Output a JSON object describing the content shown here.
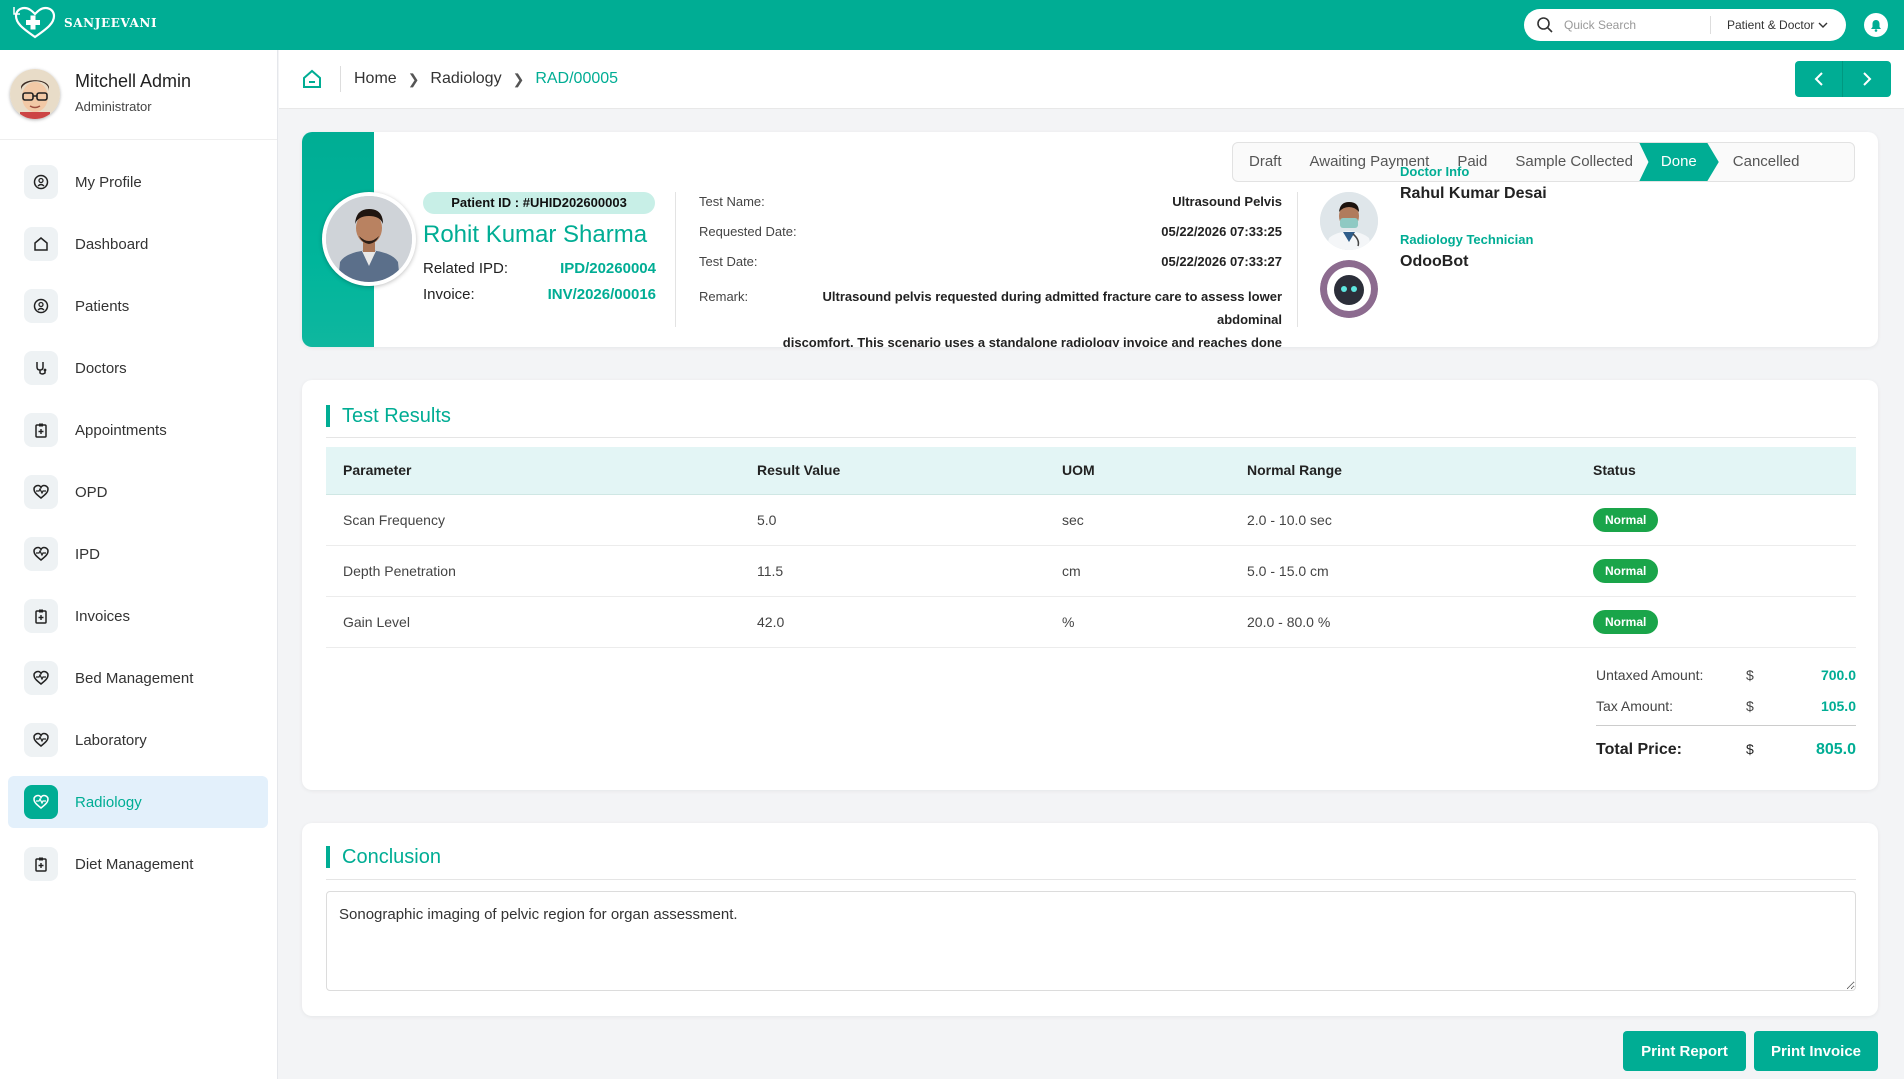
{
  "app": {
    "brand": "Sanjeevani"
  },
  "search": {
    "placeholder": "Quick Search",
    "filter_label": "Patient & Doctor"
  },
  "user": {
    "name": "Mitchell Admin",
    "role": "Administrator"
  },
  "sidebar": {
    "items": [
      {
        "label": "My Profile",
        "icon": "user-circle-icon"
      },
      {
        "label": "Dashboard",
        "icon": "home-icon"
      },
      {
        "label": "Patients",
        "icon": "user-circle-icon"
      },
      {
        "label": "Doctors",
        "icon": "stethoscope-icon"
      },
      {
        "label": "Appointments",
        "icon": "clipboard-icon"
      },
      {
        "label": "OPD",
        "icon": "heart-pulse-icon"
      },
      {
        "label": "IPD",
        "icon": "heart-pulse-icon"
      },
      {
        "label": "Invoices",
        "icon": "clipboard-icon"
      },
      {
        "label": "Bed Management",
        "icon": "heart-pulse-icon"
      },
      {
        "label": "Laboratory",
        "icon": "heart-pulse-icon"
      },
      {
        "label": "Radiology",
        "icon": "heart-pulse-icon",
        "active": true
      },
      {
        "label": "Diet Management",
        "icon": "clipboard-icon"
      }
    ]
  },
  "breadcrumb": {
    "home": "Home",
    "section": "Radiology",
    "current": "RAD/00005"
  },
  "patient": {
    "id_label": "Patient ID :",
    "id": "#UHID202600003",
    "name": "Rohit Kumar Sharma",
    "ipd_label": "Related IPD:",
    "ipd": "IPD/20260004",
    "invoice_label": "Invoice:",
    "invoice": "INV/2026/00016"
  },
  "test": {
    "name_label": "Test Name:",
    "name": "Ultrasound Pelvis",
    "requested_label": "Requested Date:",
    "requested": "05/22/2026 07:33:25",
    "date_label": "Test Date:",
    "date": "05/22/2026 07:33:27",
    "remark_label": "Remark:",
    "remark_line1": "Ultrasound pelvis requested during admitted fracture care to assess lower abdominal",
    "remark_line2": "discomfort. This scenario uses a standalone radiology invoice and reaches done state."
  },
  "statuses": [
    "Draft",
    "Awaiting Payment",
    "Paid",
    "Sample Collected",
    "Done",
    "Cancelled"
  ],
  "active_status": "Done",
  "doctor": {
    "label": "Doctor Info",
    "name": "Rahul Kumar Desai"
  },
  "technician": {
    "label": "Radiology Technician",
    "name": "OdooBot"
  },
  "results": {
    "title": "Test Results",
    "columns": [
      "Parameter",
      "Result Value",
      "UOM",
      "Normal Range",
      "Status"
    ],
    "rows": [
      [
        "Scan Frequency",
        "5.0",
        "sec",
        "2.0 - 10.0 sec",
        "Normal"
      ],
      [
        "Depth Penetration",
        "11.5",
        "cm",
        "5.0 - 15.0 cm",
        "Normal"
      ],
      [
        "Gain Level",
        "42.0",
        "%",
        "20.0 - 80.0 %",
        "Normal"
      ]
    ],
    "status_color": "#1aa54a"
  },
  "totals": {
    "untaxed_label": "Untaxed Amount:",
    "untaxed": "700.0",
    "tax_label": "Tax Amount:",
    "tax": "105.0",
    "total_label": "Total Price:",
    "total": "805.0",
    "currency": "$"
  },
  "conclusion": {
    "title": "Conclusion",
    "text": "Sonographic imaging of pelvic region for organ assessment."
  },
  "buttons": {
    "print_report": "Print Report",
    "print_invoice": "Print Invoice"
  },
  "colors": {
    "accent": "#00ad94",
    "active_nav_bg": "#e3f0fb"
  }
}
